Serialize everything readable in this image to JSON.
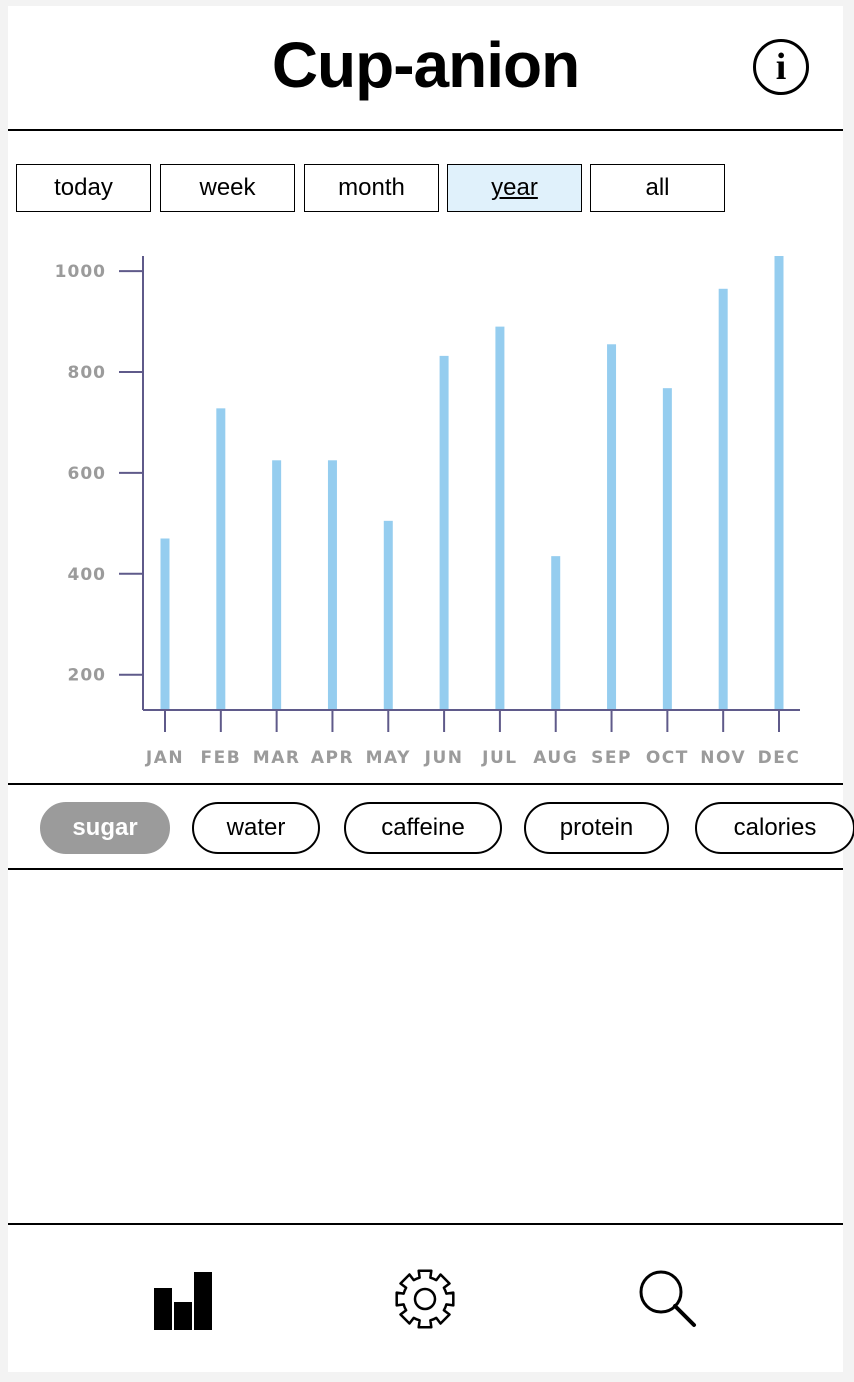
{
  "header": {
    "title": "Cup-anion",
    "info_icon": "info-icon"
  },
  "time_tabs": [
    {
      "label": "today",
      "active": false
    },
    {
      "label": "week",
      "active": false
    },
    {
      "label": "month",
      "active": false
    },
    {
      "label": "year",
      "active": true
    },
    {
      "label": "all",
      "active": false
    }
  ],
  "chart_data": {
    "type": "bar",
    "categories": [
      "JAN",
      "FEB",
      "MAR",
      "APR",
      "MAY",
      "JUN",
      "JUL",
      "AUG",
      "SEP",
      "OCT",
      "NOV",
      "DEC"
    ],
    "values": [
      470,
      728,
      625,
      625,
      505,
      832,
      890,
      435,
      855,
      768,
      965,
      1030
    ],
    "yticks": [
      200,
      400,
      600,
      800,
      1000
    ],
    "ylim": [
      130,
      1030
    ],
    "bar_color": "#95cdef",
    "axis_color": "#5f5a8a",
    "tick_label_color": "#9b9b9b",
    "grid": false
  },
  "nutrient_pills": [
    {
      "label": "sugar",
      "active": true
    },
    {
      "label": "water",
      "active": false
    },
    {
      "label": "caffeine",
      "active": false
    },
    {
      "label": "protein",
      "active": false
    },
    {
      "label": "calories",
      "active": false
    }
  ],
  "bottom_nav": {
    "items": [
      {
        "icon": "bar-chart-icon"
      },
      {
        "icon": "gear-icon"
      },
      {
        "icon": "search-icon"
      }
    ]
  },
  "colors": {
    "active_tab_bg": "#e0f1fb",
    "active_pill_bg": "#9b9b9b",
    "page_bg": "#f3f3f3"
  }
}
